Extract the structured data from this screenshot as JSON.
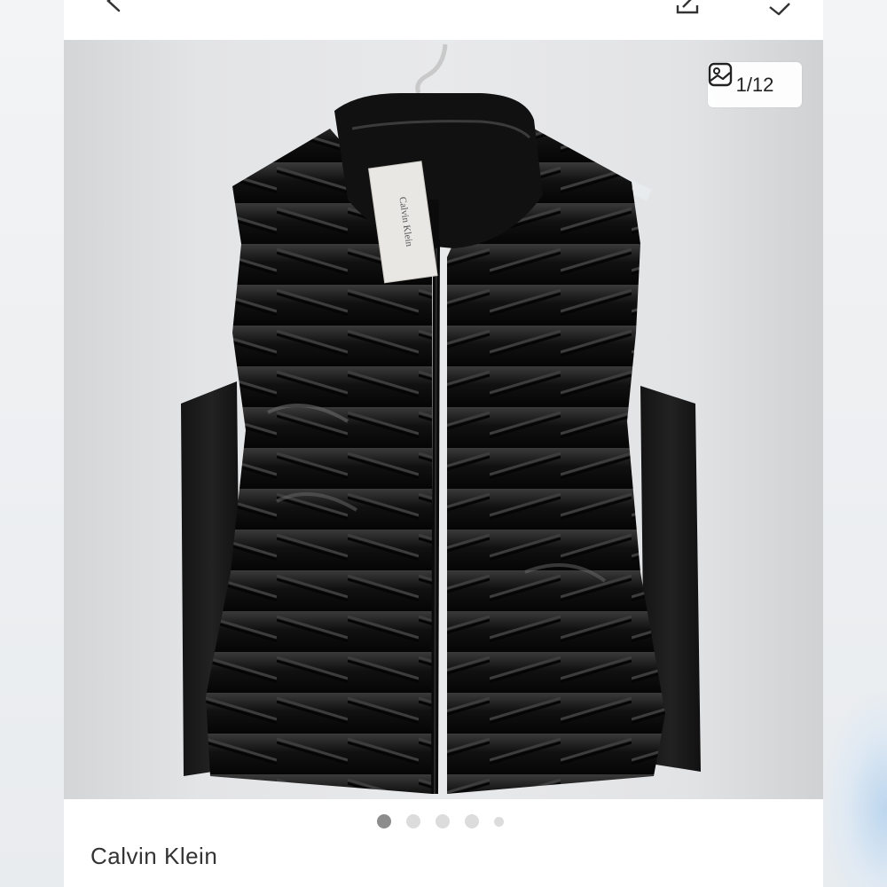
{
  "photo": {
    "counter_text": "1/12",
    "counter_icon": "image-gallery-icon",
    "tag_label_text": "Calvin Klein"
  },
  "topbar": {
    "back_icon": "back-arrow-icon",
    "share_icon": "share-icon",
    "tag_icon": "price-tag-icon"
  },
  "carousel": {
    "dots": [
      {
        "state": "active"
      },
      {
        "state": "inactive"
      },
      {
        "state": "inactive"
      },
      {
        "state": "inactive"
      },
      {
        "state": "inactive-small"
      }
    ]
  },
  "listing": {
    "brand": "Calvin Klein"
  },
  "colors": {
    "vest": "#151515",
    "background": "#e6e7e9",
    "active_dot": "#8c8c8c",
    "inactive_dot": "#dcdcdc"
  }
}
